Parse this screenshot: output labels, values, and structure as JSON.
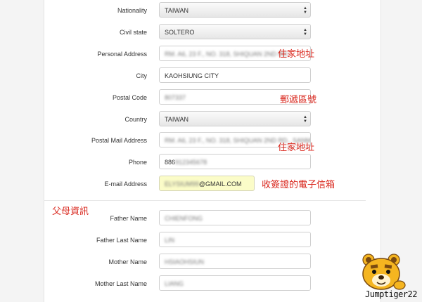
{
  "form": {
    "nationality": {
      "label": "Nationality",
      "value": "TAIWAN"
    },
    "civil_state": {
      "label": "Civil state",
      "value": "SOLTERO"
    },
    "personal_address": {
      "label": "Personal Address",
      "value": "RM. A6, 23 F., NO. 318, SHIQUAN 2ND RD."
    },
    "city": {
      "label": "City",
      "value": "KAOHSIUNG CITY"
    },
    "postal_code": {
      "label": "Postal Code",
      "value": "807337"
    },
    "country": {
      "label": "Country",
      "value": "TAIWAN"
    },
    "postal_mail_address": {
      "label": "Postal Mail Address",
      "value": "RM. A6, 23 F., NO. 318, SHIQUAN 2ND RD., SANMIN"
    },
    "phone": {
      "label": "Phone",
      "value": "886",
      "value_blur": "912345678"
    },
    "email": {
      "label": "E-mail Address",
      "value_blur": "ELYSIUM99",
      "value": "@GMAIL.COM"
    },
    "father_name": {
      "label": "Father Name",
      "value": "CHIENFONG"
    },
    "father_last_name": {
      "label": "Father Last Name",
      "value": "LIN"
    },
    "mother_name": {
      "label": "Mother Name",
      "value": "HSIAOHSIUN"
    },
    "mother_last_name": {
      "label": "Mother Last Name",
      "value": "LIANG"
    }
  },
  "annotations": {
    "home_address_1": "住家地址",
    "postal_code_note": "郵遞區號",
    "home_address_2": "住家地址",
    "email_note": "收簽證的電子信箱",
    "parents_info": "父母資訊"
  },
  "branding": {
    "watermark": "Jumptiger22",
    "mascot_icon": "tiger-mascot-icon"
  },
  "colors": {
    "annotation_red": "#d9261c",
    "email_highlight": "#fbfcc8"
  }
}
